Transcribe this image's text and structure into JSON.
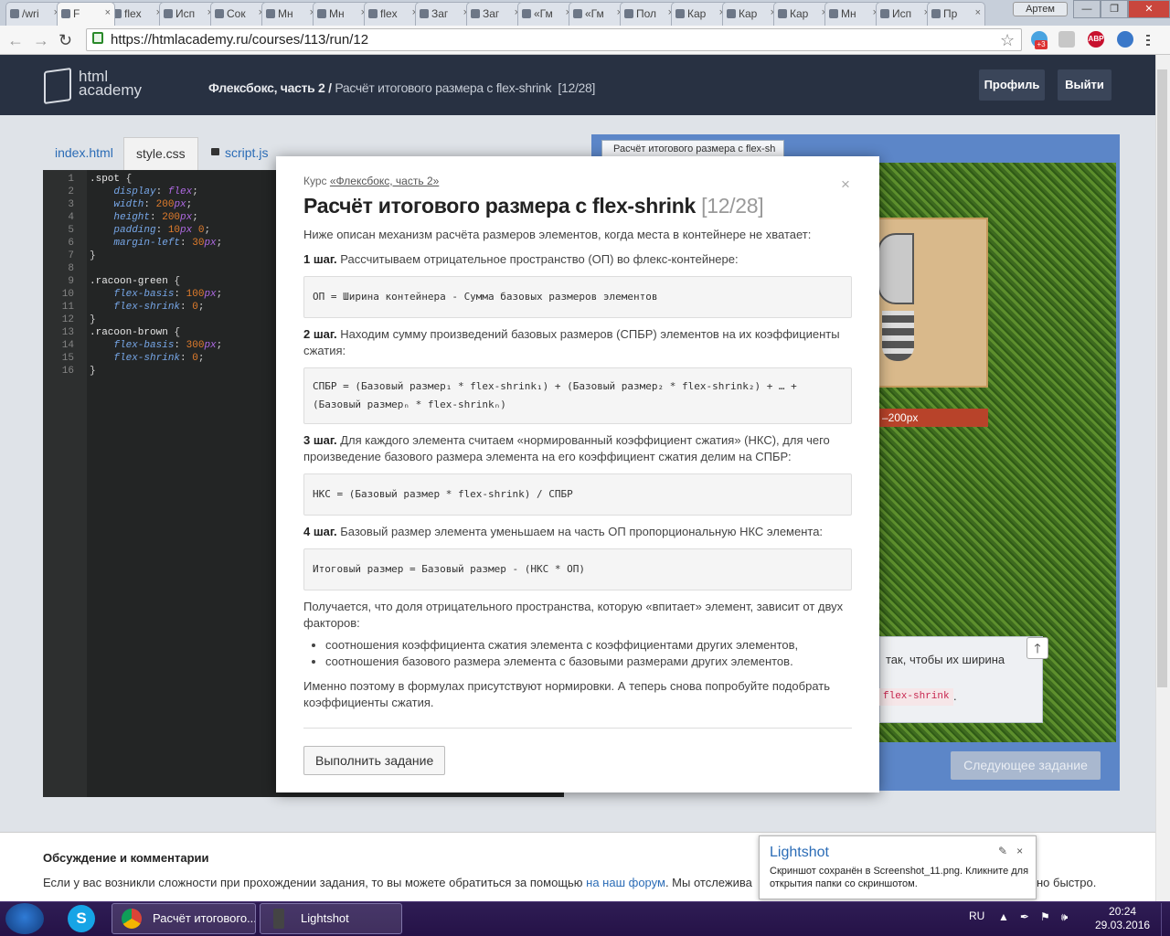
{
  "browser": {
    "tabs": [
      {
        "label": "/wri"
      },
      {
        "label": "F"
      },
      {
        "label": "flex"
      },
      {
        "label": "Исп"
      },
      {
        "label": "Сок"
      },
      {
        "label": "Мн"
      },
      {
        "label": "Мн"
      },
      {
        "label": "flex"
      },
      {
        "label": "Заг"
      },
      {
        "label": "Заг"
      },
      {
        "label": "«Гм"
      },
      {
        "label": "«Гм"
      },
      {
        "label": "Пол"
      },
      {
        "label": "Кар"
      },
      {
        "label": "Кар"
      },
      {
        "label": "Кар"
      },
      {
        "label": "Мн"
      },
      {
        "label": "Исп"
      },
      {
        "label": "Пр"
      }
    ],
    "profile_name": "Артем",
    "url": "https://htmlacademy.ru/courses/113/run/12",
    "abp_label": "ABP",
    "badge_count": "+3"
  },
  "header": {
    "logo_line1": "html",
    "logo_line2": "academy",
    "breadcrumb_course": "Флексбокс, часть 2",
    "breadcrumb_sep": " / ",
    "breadcrumb_task": "Расчёт итогового размера с flex-shrink",
    "breadcrumb_counter": "[12/28]",
    "profile_button": "Профиль",
    "logout_button": "Выйти"
  },
  "editor": {
    "tabs": [
      {
        "label": "index.html"
      },
      {
        "label": "style.css"
      },
      {
        "label": "script.js"
      }
    ],
    "line_numbers": [
      "1",
      "2",
      "3",
      "4",
      "5",
      "6",
      "7",
      "8",
      "9",
      "10",
      "11",
      "12",
      "13",
      "14",
      "15",
      "16"
    ]
  },
  "preview": {
    "tab_label": "Расчёт итогового размера с flex-sh",
    "size_label": "–200px",
    "task_text": "так, чтобы их ширина",
    "task_code": "flex-shrink",
    "task_dot": ".",
    "next_button": "Следующее задание"
  },
  "modal": {
    "course_prefix": "Курс ",
    "course_link": "«Флексбокс, часть 2»",
    "title": "Расчёт итогового размера с flex-shrink",
    "counter": "[12/28]",
    "intro": "Ниже описан механизм расчёта размеров элементов, когда места в контейнере не хватает:",
    "step1_label": "1 шаг.",
    "step1_text": " Рассчитываем отрицательное пространство (ОП) во флекс-контейнере:",
    "code1": "ОП = Ширина контейнера - Сумма базовых размеров элементов",
    "step2_label": "2 шаг.",
    "step2_text": " Находим сумму произведений базовых размеров (СПБР) элементов на их коэффициенты сжатия:",
    "code2": "СПБР = (Базовый размер₁ * flex-shrink₁) + (Базовый размер₂ * flex-shrink₂) + … + (Базовый размерₙ * flex-shrinkₙ)",
    "step3_label": "3 шаг.",
    "step3_text": " Для каждого элемента считаем «нормированный коэффициент сжатия» (НКС), для чего произведение базового размера элемента на его коэффициент сжатия делим на СПБР:",
    "code3": "НКС = (Базовый размер * flex-shrink) / СПБР",
    "step4_label": "4 шаг.",
    "step4_text": " Базовый размер элемента уменьшаем на часть ОП пропорциональную НКС элемента:",
    "code4": "Итоговый размер = Базовый размер - (НКС * ОП)",
    "factors_text": "Получается, что доля отрицательного пространства, которую «впитает» элемент, зависит от двух факторов:",
    "factors": [
      "соотношения коэффициента сжатия элемента с коэффициентами других элементов,",
      "соотношения базового размера элемента с базовыми размерами других элементов."
    ],
    "outro": "Именно поэтому в формулах присутствуют нормировки. А теперь снова попробуйте подобрать коэффициенты сжатия.",
    "run_button": "Выполнить задание",
    "close_symbol": "×"
  },
  "discussion": {
    "title": "Обсуждение и комментарии",
    "text_before": "Если у вас возникли сложности при прохождении задания, то вы можете обратиться за помощью ",
    "link": "на наш форум",
    "text_after": ". Мы отслежива",
    "tail": "но быстро."
  },
  "lightshot": {
    "title": "Lightshot",
    "text": "Скриншот сохранён в Screenshot_11.png. Кликните для открытия папки со скриншотом.",
    "close_symbol": "×"
  },
  "taskbar": {
    "items": [
      {
        "label": "Расчёт итогового..."
      },
      {
        "label": "Lightshot"
      }
    ],
    "skype_letter": "S",
    "lang": "RU",
    "time": "20:24",
    "date": "29.03.2016"
  },
  "colors": {
    "header_bg": "#283142",
    "link_blue": "#2b6cb6",
    "preview_frame": "#5c86c8",
    "taskbar_bg": "#2f1d55"
  }
}
